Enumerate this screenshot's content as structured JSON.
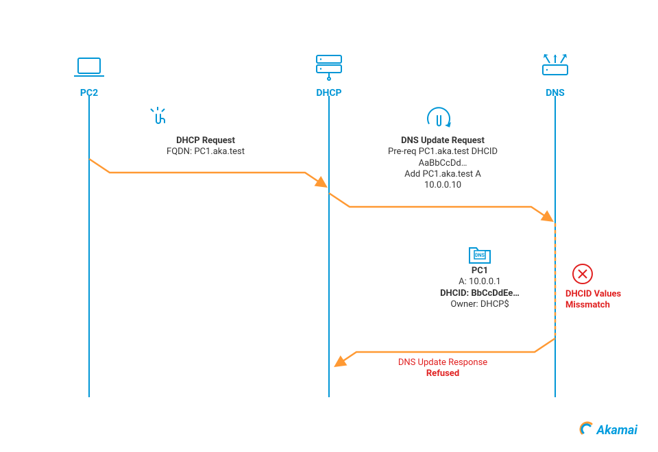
{
  "nodes": {
    "pc2": {
      "label": "PC2"
    },
    "dhcp": {
      "label": "DHCP"
    },
    "dns": {
      "label": "DNS"
    }
  },
  "messages": {
    "dhcp_request": {
      "title": "DHCP Request",
      "fqdn": "FQDN: PC1.aka.test"
    },
    "dns_update_request": {
      "title": "DNS Update Request",
      "prereq": "Pre-req PC1.aka.test DHCID",
      "prereq_val": "AaBbCcDd…",
      "add": "Add PC1.aka.test A",
      "ip": "10.0.0.10"
    },
    "dns_update_response": {
      "title": "DNS Update Response",
      "status": "Refused"
    }
  },
  "dns_record": {
    "host": "PC1",
    "a": "A: 10.0.0.1",
    "dhcid": "DHCID: BbCcDdEe…",
    "owner": "Owner: DHCP$"
  },
  "error": {
    "line1": "DHCID Values",
    "line2": "Missmatch"
  },
  "brand": "Akamai"
}
